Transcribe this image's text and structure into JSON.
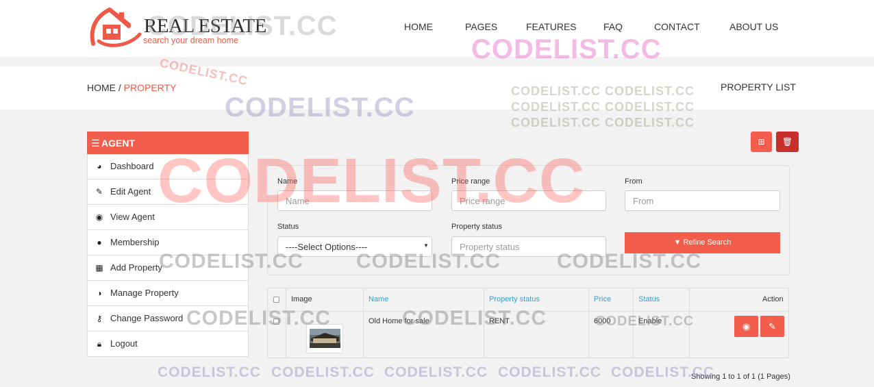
{
  "brand": {
    "name": "REAL ESTATE",
    "tagline": "search your dream home",
    "accent_color": "#f25d4c",
    "link_color": "#3a9dc8"
  },
  "nav": {
    "home": "HOME",
    "pages": "PAGES",
    "features": "FEATURES",
    "faq": "FAQ",
    "contact": "CONTACT",
    "about": "ABOUT US"
  },
  "breadcrumb": {
    "home": "HOME",
    "separator": "/",
    "current": "PROPERTY",
    "page_heading": "PROPERTY LIST"
  },
  "sidebar": {
    "title": "AGENT",
    "title_icon": "list-icon",
    "items": [
      {
        "label": "Dashboard",
        "icon": "dashboard-icon"
      },
      {
        "label": "Edit Agent",
        "icon": "edit-icon"
      },
      {
        "label": "View Agent",
        "icon": "eye-icon"
      },
      {
        "label": "Membership",
        "icon": "user-icon"
      },
      {
        "label": "Add Property",
        "icon": "building-icon"
      },
      {
        "label": "Manage Property",
        "icon": "adjust-icon"
      },
      {
        "label": "Change Password",
        "icon": "key-icon"
      },
      {
        "label": "Logout",
        "icon": "lock-icon"
      }
    ]
  },
  "toolbar": {
    "add_icon": "plus-square-icon",
    "delete_icon": "trash-icon"
  },
  "search": {
    "name_label": "Name",
    "name_placeholder": "Name",
    "price_label": "Price range",
    "price_placeholder": "Price range",
    "from_label": "From",
    "from_placeholder": "From",
    "status_label": "Status",
    "status_selected": "----Select Options----",
    "property_status_label": "Property status",
    "property_status_placeholder": "Property status",
    "refine_label": "Refine Search"
  },
  "table": {
    "columns": [
      "Image",
      "Name",
      "Property status",
      "Price",
      "Status",
      "Action"
    ],
    "rows": [
      {
        "name": "Old Home for sale",
        "property_status": "RENT",
        "price": "6000",
        "status": "Enable"
      }
    ]
  },
  "pagination": {
    "summary": "Showing 1 to 1 of 1 (1 Pages)"
  },
  "watermark": {
    "text": "CODELIST.CC",
    "pair": "CODELIST.CC CODELIST.CC"
  }
}
